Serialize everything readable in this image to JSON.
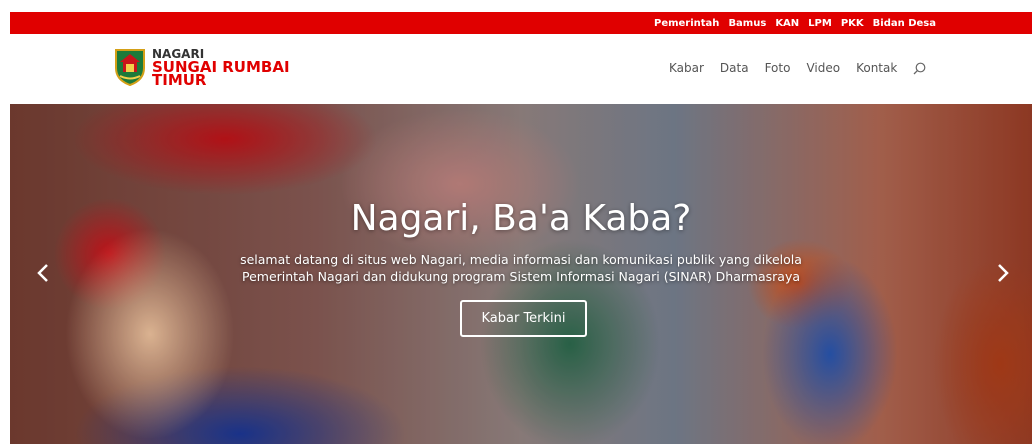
{
  "topbar": {
    "links": [
      "Pemerintah",
      "Bamus",
      "KAN",
      "LPM",
      "PKK",
      "Bidan Desa"
    ],
    "color": "#e00000"
  },
  "logo": {
    "line1": "NAGARI",
    "line2": "SUNGAI RUMBAI",
    "line3": "TIMUR"
  },
  "nav": {
    "items": [
      "Kabar",
      "Data",
      "Foto",
      "Video",
      "Kontak"
    ],
    "search_icon": "search-icon"
  },
  "hero": {
    "title": "Nagari, Ba'a Kaba?",
    "subtitle_line1": "selamat datang di situs web Nagari, media informasi dan komunikasi publik yang dikelola",
    "subtitle_line2": "Pemerintah Nagari dan didukung program Sistem Informasi Nagari (SINAR) Dharmasraya",
    "button_label": "Kabar Terkini",
    "prev_icon": "chevron-left-icon",
    "next_icon": "chevron-right-icon"
  }
}
